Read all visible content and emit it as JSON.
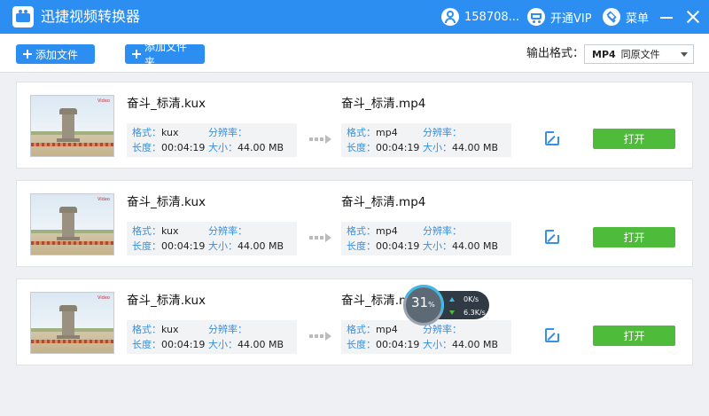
{
  "window": {
    "title": "迅捷视频转换器",
    "user": "158708...",
    "vip_label": "开通VIP",
    "menu_label": "菜单"
  },
  "toolbar": {
    "add_file_label": "添加文件",
    "add_folder_label": "添加文件夹",
    "output_format_label": "输出格式：",
    "output_format_value": "MP4",
    "output_format_option": "同原文件"
  },
  "labels": {
    "format": "格式：",
    "resolution": "分辨率：",
    "duration": "长度：",
    "size": "大小：",
    "open": "打开"
  },
  "thumb_watermark": "Video",
  "files": [
    {
      "source_name": "奋斗_标清.kux",
      "source_format": "kux",
      "source_resolution": "",
      "source_duration": "00:04:19",
      "source_size": "44.00 MB",
      "target_name": "奋斗_标清.mp4",
      "target_format": "mp4",
      "target_resolution": "",
      "target_duration": "00:04:19",
      "target_size": "44.00 MB"
    },
    {
      "source_name": "奋斗_标清.kux",
      "source_format": "kux",
      "source_resolution": "",
      "source_duration": "00:04:19",
      "source_size": "44.00 MB",
      "target_name": "奋斗_标清.mp4",
      "target_format": "mp4",
      "target_resolution": "",
      "target_duration": "00:04:19",
      "target_size": "44.00 MB"
    },
    {
      "source_name": "奋斗_标清.kux",
      "source_format": "kux",
      "source_resolution": "",
      "source_duration": "00:04:19",
      "source_size": "44.00 MB",
      "target_name": "奋斗_标清.mp4",
      "target_format": "mp4",
      "target_resolution": "",
      "target_duration": "00:04:19",
      "target_size": "44.00 MB"
    }
  ],
  "progress": {
    "percent": "31",
    "percent_unit": "%",
    "upload_speed": "0",
    "download_speed": "6.3",
    "speed_unit": "K/s"
  },
  "colors": {
    "titlebar": "#2b8ef0",
    "accent": "#2b8ef0",
    "open_button": "#4fbb3a",
    "label_blue": "#3a8fe0"
  }
}
